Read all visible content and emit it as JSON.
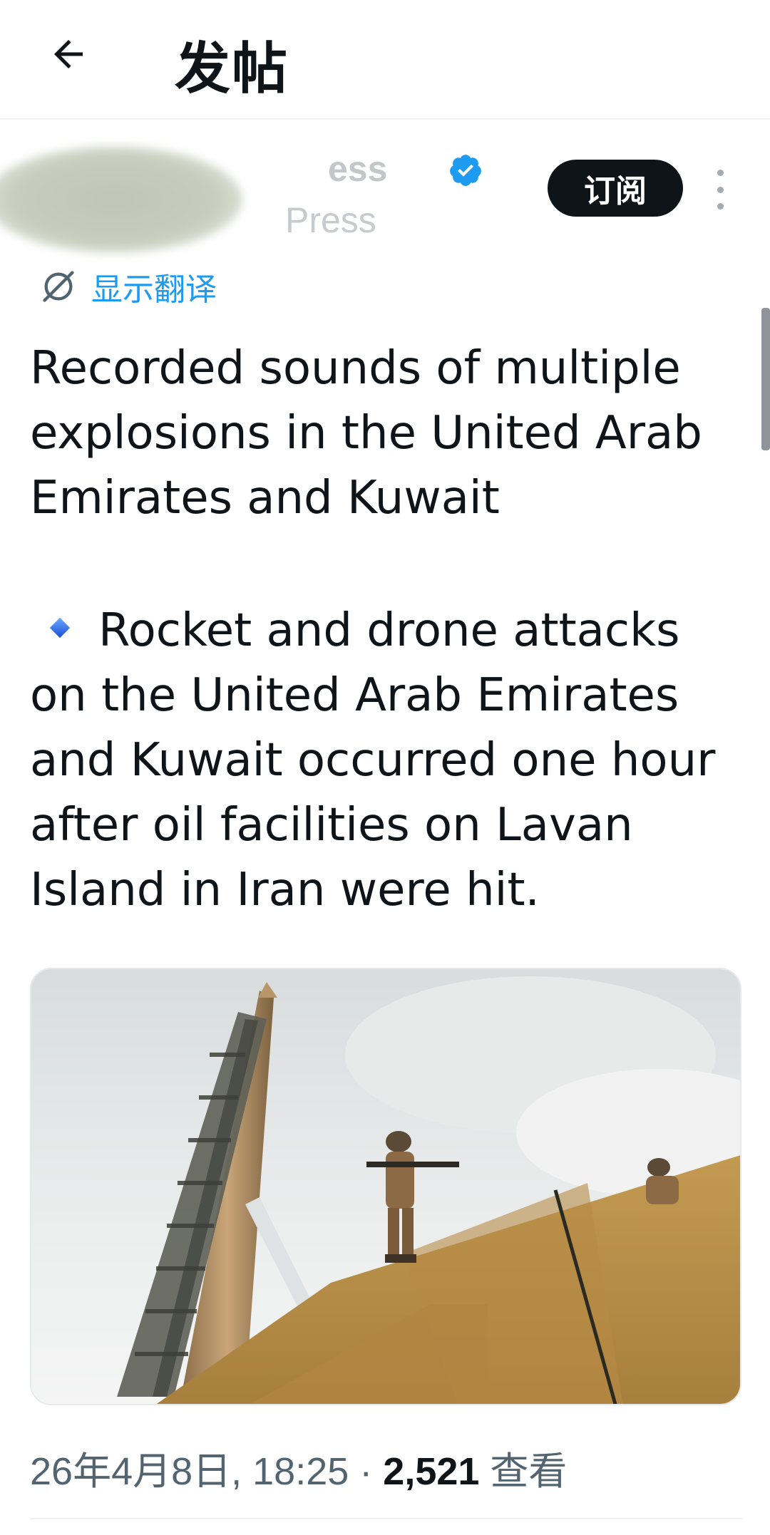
{
  "header": {
    "title": "发帖",
    "back_icon": "arrow-left-icon"
  },
  "author": {
    "name_partial": "ess",
    "handle_partial": "Press",
    "verified_icon": "verified-badge-icon",
    "verified_color": "#1d9bf0"
  },
  "subscribe_label": "订阅",
  "more_icon": "more-vertical-icon",
  "translate": {
    "icon": "translate-icon",
    "label": "显示翻译",
    "color": "#1d9bf0"
  },
  "post": {
    "paragraph1": "Recorded sounds of multiple explosions in the United Arab Emirates and Kuwait",
    "bullet_icon": "blue-diamond-icon",
    "paragraph2": "Rocket and drone attacks on the United Arab Emirates and Kuwait occurred one hour after oil facilities on Lavan Island in Iran were hit."
  },
  "media": {
    "description_icon": "photo"
  },
  "meta": {
    "datetime": "26年4月8日, 18:25",
    "separator": " · ",
    "views_count": "2,521",
    "views_label": " 查看"
  }
}
